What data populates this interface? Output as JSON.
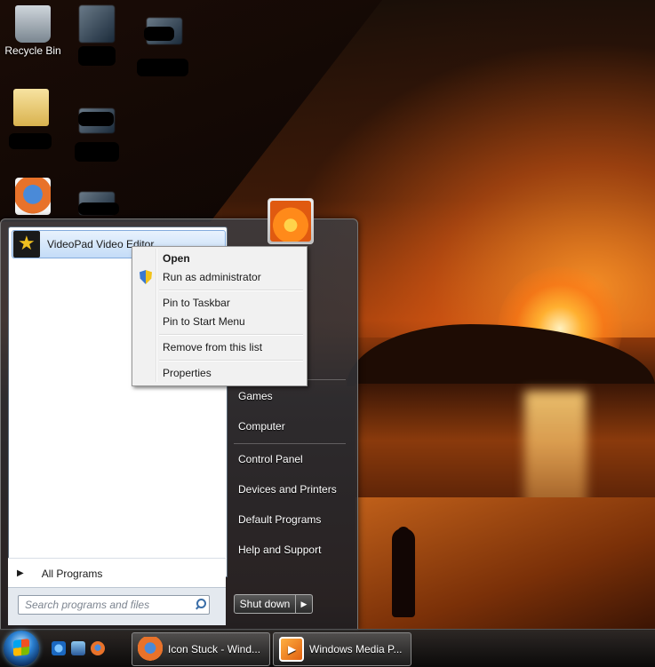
{
  "desktop": {
    "icons": [
      {
        "label": "Recycle Bin",
        "icon": "recycle-bin-icon"
      },
      {
        "label": "",
        "icon": "file-icon"
      },
      {
        "label": "",
        "icon": "video-file-icon"
      },
      {
        "label": "",
        "icon": "folder-icon"
      },
      {
        "label": "",
        "icon": "video-file-icon"
      },
      {
        "label": "",
        "icon": "firefox-icon"
      },
      {
        "label": "",
        "icon": "file-icon"
      }
    ]
  },
  "start_menu": {
    "pinned_program": {
      "label": "VideoPad Video Editor",
      "icon": "videopad-icon"
    },
    "all_programs": "All Programs",
    "search_placeholder": "Search programs and files",
    "right_links": [
      "Games",
      "Computer",
      "Control Panel",
      "Devices and Printers",
      "Default Programs",
      "Help and Support"
    ],
    "shutdown_label": "Shut down",
    "shutdown_arrow": "▶"
  },
  "context_menu": {
    "items": [
      {
        "label": "Open",
        "bold": true
      },
      {
        "label": "Run as administrator",
        "icon": "uac-shield-icon"
      },
      {
        "label": "Pin to Taskbar"
      },
      {
        "label": "Pin to Start Menu"
      },
      {
        "label": "Remove from this list"
      },
      {
        "label": "Properties"
      }
    ]
  },
  "taskbar": {
    "quick_launch": [
      "internet-explorer-icon",
      "show-desktop-icon",
      "firefox-icon"
    ],
    "buttons": [
      {
        "label": "Icon Stuck - Wind...",
        "icon": "firefox-icon"
      },
      {
        "label": "Windows Media P...",
        "icon": "windows-media-player-icon"
      }
    ]
  }
}
